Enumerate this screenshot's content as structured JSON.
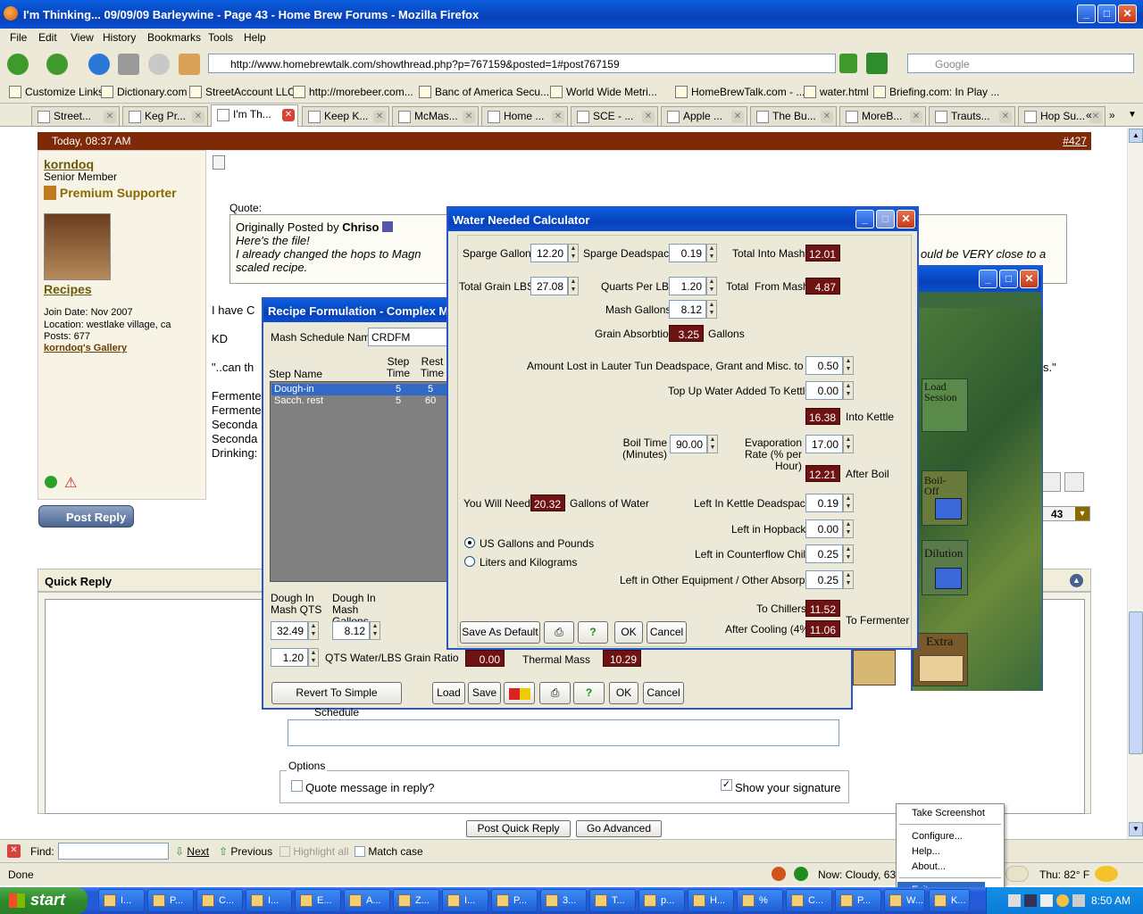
{
  "window": {
    "title": "I'm Thinking... 09/09/09 Barleywine - Page 43 - Home Brew Forums - Mozilla Firefox"
  },
  "menu": [
    "File",
    "Edit",
    "View",
    "History",
    "Bookmarks",
    "Tools",
    "Help"
  ],
  "url": "http://www.homebrewtalk.com/showthread.php?p=767159&posted=1#post767159",
  "search_placeholder": "Google",
  "bookmarks": [
    "Customize Links",
    "Dictionary.com",
    "StreetAccount LLC",
    "http://morebeer.com...",
    "Banc of America Secu...",
    "World Wide Metri...",
    "HomeBrewTalk.com - ...",
    "water.html",
    "Briefing.com: In Play ..."
  ],
  "tabs": [
    "Street...",
    "Keg Pr...",
    "I'm Th...",
    "Keep K...",
    "McMas...",
    "Home ...",
    "SCE - ...",
    "Apple ...",
    "The Bu...",
    "MoreB...",
    "Trauts...",
    "Hop Su..."
  ],
  "post": {
    "date": "Today, 08:37 AM",
    "number": "#427",
    "user": "korndoq",
    "rank": "Senior Member",
    "badge": "Premium Supporter",
    "recipes": "Recipes",
    "join": "Join Date: Nov 2007",
    "location": "Location: westlake village, ca",
    "posts": "Posts: 677",
    "gallery": "korndoq's Gallery",
    "quote_label": "Quote:",
    "orig": "Originally Posted by",
    "orig_user": "Chriso",
    "quote1": "Here's the file!",
    "quote2": "I already changed the hops to Magn",
    "quote2_end": "ould be VERY close to a",
    "quote3": "scaled recipe.",
    "body1": "I have C",
    "body2": "KD",
    "body3": "\"..can th",
    "body3_end": "s.\"",
    "ferm1": "Fermente",
    "ferm2": "Fermente",
    "sec1": "Seconda",
    "sec2": "Seconda",
    "drink": "Drinking:",
    "post_reply": "Post Reply",
    "page_no": "43"
  },
  "quick_reply": {
    "title": "Quick Reply",
    "options": "Options",
    "quote_msg": "Quote message in reply?",
    "show_sig": "Show your signature",
    "post_btn": "Post Quick Reply",
    "advanced_btn": "Go Advanced"
  },
  "find": {
    "label": "Find:",
    "next": "Next",
    "previous": "Previous",
    "highlight": "Highlight all",
    "match": "Match case"
  },
  "status": {
    "done": "Done",
    "weather": "Now: Cloudy, 63°",
    "forecast": "Thu: 82° F"
  },
  "context_menu": [
    "Take Screenshot",
    "Configure...",
    "Help...",
    "About...",
    "Exit"
  ],
  "recipe": {
    "title": "Recipe Formulation - Complex M",
    "schedule_label": "Mash Schedule Name:",
    "schedule_name": "CRDFM",
    "col_step": "Step Name",
    "col_step_time": "Step Time",
    "col_rest_time": "Rest Time",
    "rows": [
      {
        "name": "Dough-in",
        "step": "5",
        "rest": "5"
      },
      {
        "name": "Sacch. rest",
        "step": "5",
        "rest": "60"
      }
    ],
    "dough_qts_label": "Dough In Mash QTS",
    "dough_gal_label": "Dough In Mash Gallons",
    "dough_qts": "32.49",
    "dough_gal": "8.12",
    "ratio": "1.20",
    "ratio_label": "QTS Water/LBS Grain Ratio",
    "out1": "0.00",
    "thermal_label": "Thermal Mass",
    "thermal": "10.29",
    "revert": "Revert To Simple Schedule",
    "load": "Load",
    "save": "Save",
    "help": "?",
    "ok": "OK",
    "cancel": "Cancel"
  },
  "bg_window": {
    "load_session": "Load Session",
    "boil_off": "Boil- Off",
    "dilution": "Dilution",
    "extra": "Extra"
  },
  "water": {
    "title": "Water Needed Calculator",
    "sparge_gal_label": "Sparge Gallons",
    "sparge_gal": "12.20",
    "sparge_dead_label": "Sparge Deadspace",
    "sparge_dead": "0.19",
    "total_into_mash_label": "Total Into Mash",
    "total_into_mash": "12.01",
    "total_grain_label": "Total Grain LBS",
    "total_grain": "27.08",
    "quarts_label": "Quarts Per LBS",
    "quarts": "1.20",
    "total_from_mash_label": "Total  From Mash",
    "total_from_mash": "4.87",
    "mash_gal_label": "Mash Gallons",
    "mash_gal": "8.12",
    "grain_abs_label": "Grain Absorbtion",
    "grain_abs": "3.25",
    "gallons": "Gallons",
    "lauter_label": "Amount Lost in Lauter Tun Deadspace, Grant and Misc. to Kettle",
    "lauter": "0.50",
    "topup_label": "Top Up Water Added To Kettle",
    "topup": "0.00",
    "into_kettle": "16.38",
    "into_kettle_label": "Into Kettle",
    "boil_time_label": "Boil Time (Minutes)",
    "boil_time": "90.00",
    "evap_label": "Evaporation Rate (% per Hour)",
    "evap": "17.00",
    "after_boil": "12.21",
    "after_boil_label": "After Boil",
    "you_need_label": "You Will Need",
    "you_need": "20.32",
    "gal_water": "Gallons of Water",
    "kettle_dead_label": "Left In Kettle Deadspace",
    "kettle_dead": "0.19",
    "hopback_label": "Left in Hopback",
    "hopback": "0.00",
    "chiller_label": "Left in Counterflow Chiller",
    "chiller": "0.25",
    "other_label": "Left in Other Equipment / Other Absorption",
    "other": "0.25",
    "units_us": "US Gallons and Pounds",
    "units_metric": "Liters and Kilograms",
    "to_chillers_label": "To Chillers",
    "to_chillers": "11.52",
    "after_cooling_label": "After Cooling (4%)",
    "after_cooling": "11.06",
    "to_fermenter": "To Fermenter",
    "save_default": "Save As Default",
    "help": "?",
    "ok": "OK",
    "cancel": "Cancel"
  },
  "taskbar": {
    "start": "start",
    "items": [
      "I...",
      "P...",
      "C...",
      "I...",
      "E...",
      "A...",
      "Z...",
      "I...",
      "P...",
      "3...",
      "T...",
      "p...",
      "H...",
      "%",
      "C...",
      "P...",
      "W...",
      "K..."
    ],
    "clock": "8:50 AM"
  }
}
